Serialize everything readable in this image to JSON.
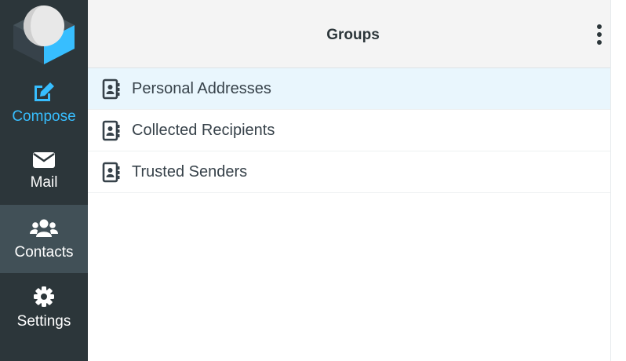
{
  "nav": {
    "items": [
      {
        "id": "compose",
        "label": "Compose",
        "icon": "compose-icon"
      },
      {
        "id": "mail",
        "label": "Mail",
        "icon": "envelope-icon"
      },
      {
        "id": "contacts",
        "label": "Contacts",
        "icon": "users-icon",
        "selected": true
      },
      {
        "id": "settings",
        "label": "Settings",
        "icon": "gear-icon"
      }
    ]
  },
  "groups": {
    "title": "Groups",
    "menu_icon": "vertical-dots-icon",
    "items": [
      {
        "name": "Personal Addresses",
        "icon": "address-book-icon",
        "selected": true
      },
      {
        "name": "Collected Recipients",
        "icon": "address-book-icon"
      },
      {
        "name": "Trusted Senders",
        "icon": "address-book-icon"
      }
    ]
  },
  "colors": {
    "nav_background": "#2c363a",
    "nav_selected": "#415057",
    "accent": "#37beff",
    "header_background": "#f4f4f4",
    "selected_row": "#e9f6fd"
  }
}
